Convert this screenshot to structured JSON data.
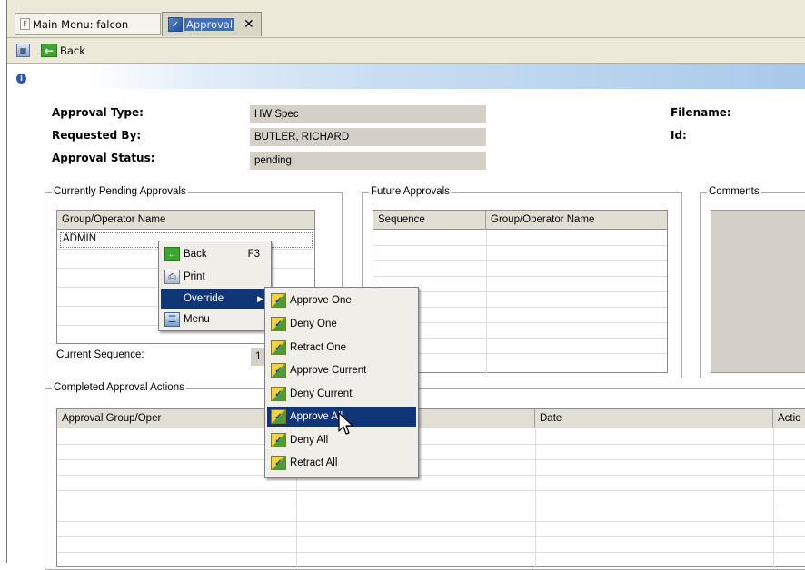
{
  "tabs": [
    {
      "label": "Main Menu: falcon"
    },
    {
      "label": "Approval",
      "close": "✕"
    }
  ],
  "toolbar": {
    "back_label": "Back"
  },
  "form": {
    "approval_type_label": "Approval Type:",
    "approval_type_value": "HW Spec",
    "requested_by_label": "Requested By:",
    "requested_by_value": "BUTLER, RICHARD",
    "approval_status_label": "Approval Status:",
    "approval_status_value": "pending",
    "filename_label": "Filename:",
    "id_label": "Id:"
  },
  "pending": {
    "title": "Currently Pending Approvals",
    "column": "Group/Operator Name",
    "rows": [
      "ADMIN"
    ],
    "current_sequence_label": "Current Sequence:",
    "current_sequence_value": "1"
  },
  "future": {
    "title": "Future Approvals",
    "columns": [
      "Sequence",
      "Group/Operator Name"
    ]
  },
  "comments": {
    "title": "Comments"
  },
  "completed": {
    "title": "Completed Approval Actions",
    "columns": [
      "Approval Group/Oper",
      "Date",
      "Actio"
    ]
  },
  "context_menu": {
    "items": [
      {
        "label": "Back",
        "shortcut": "F3",
        "icon": "back-arrow-icon"
      },
      {
        "label": "Print",
        "icon": "printer-icon"
      },
      {
        "label": "Override",
        "submenu_arrow": "▶"
      },
      {
        "label": "Menu",
        "icon": "menu-icon"
      }
    ]
  },
  "submenu": {
    "items": [
      {
        "label": "Approve One"
      },
      {
        "label": "Deny One"
      },
      {
        "label": "Retract One"
      },
      {
        "label": "Approve Current"
      },
      {
        "label": "Deny Current"
      },
      {
        "label": "Approve All",
        "selected": true
      },
      {
        "label": "Deny All"
      },
      {
        "label": "Retract All"
      }
    ]
  },
  "colors": {
    "menu_highlight": "#113678",
    "chrome": "#ece9d8",
    "field_bg": "#d4d0c8"
  }
}
